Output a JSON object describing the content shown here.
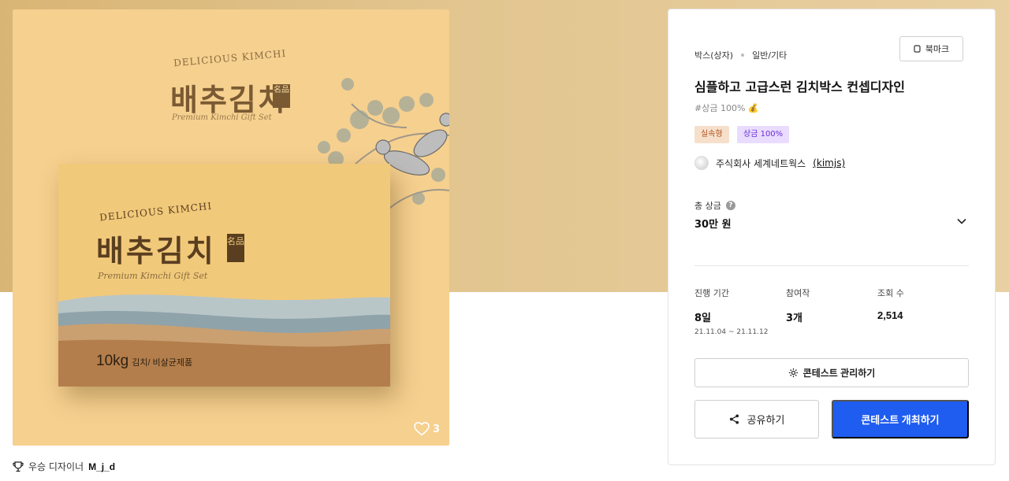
{
  "hero": {
    "background": "#dcb87a"
  },
  "image": {
    "big_title": "배추김치",
    "big_en": "DELICIOUS KIMCHI",
    "big_sub": "Premium Kimchi Gift Set",
    "big_stamp": "名品",
    "box_title": "배추김치",
    "box_en": "DELICIOUS KIMCHI",
    "box_sub": "Premium Kimchi Gift Set",
    "box_stamp": "名品",
    "box_weight": "10kg",
    "box_desc": "김치/ 비살균제품",
    "likes": "3"
  },
  "winner": {
    "label": "우승 디자이너",
    "name": "M_j_d"
  },
  "contest": {
    "category": "박스(상자)",
    "subcategory": "일반/기타",
    "bookmark_label": "북마크",
    "title": "심플하고 고급스런 김치박스 컨셉디자인",
    "prize_tag": "#상금 100% 💰",
    "badges": [
      "실속형",
      "상금 100%"
    ],
    "host_name": "주식회사 세계네트웍스",
    "host_id": "(kimjs)",
    "prize_label": "총 상금",
    "prize_value": "30만 원",
    "stats": [
      {
        "label": "진행 기간",
        "value": "8일",
        "dates": "21.11.04 ~ 21.11.12"
      },
      {
        "label": "참여작",
        "value": "3개"
      },
      {
        "label": "조회 수",
        "value": "2,514"
      }
    ],
    "manage_label": "콘테스트 관리하기",
    "share_label": "공유하기",
    "open_label": "콘테스트 개최하기"
  },
  "colors": {
    "primary": "#1f5cf0",
    "badge_a": "#f6e0cc",
    "badge_b": "#eadcff"
  }
}
